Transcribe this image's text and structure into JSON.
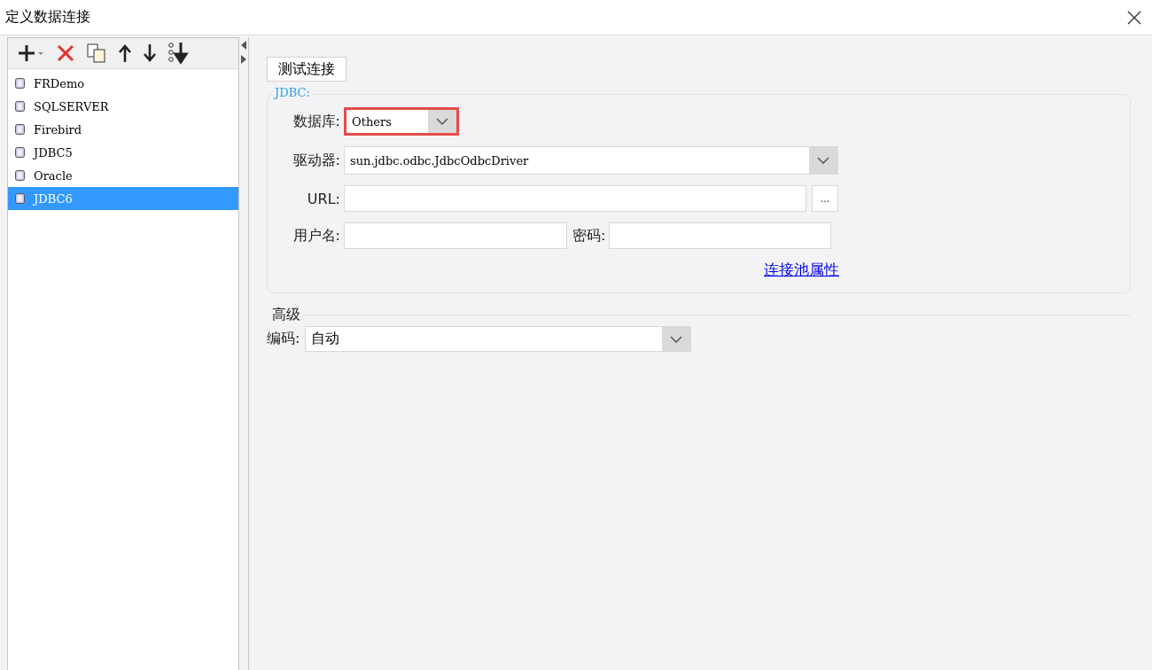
{
  "window": {
    "title": "定义数据连接"
  },
  "connections": [
    {
      "name": "FRDemo",
      "selected": false
    },
    {
      "name": "SQLSERVER",
      "selected": false
    },
    {
      "name": "Firebird",
      "selected": false
    },
    {
      "name": "JDBC5",
      "selected": false
    },
    {
      "name": "Oracle",
      "selected": false
    },
    {
      "name": "JDBC6",
      "selected": true
    }
  ],
  "test_button": "测试连接",
  "jdbc": {
    "legend": "JDBC:",
    "database": {
      "label": "数据库:",
      "value": "Others",
      "highlighted": true
    },
    "driver": {
      "label": "驱动器:",
      "value": "sun.jdbc.odbc.JdbcOdbcDriver"
    },
    "url": {
      "label": "URL:",
      "browse": "..."
    },
    "username": {
      "label": "用户名:"
    },
    "password": {
      "label": "密码:"
    },
    "pool_link": "连接池属性"
  },
  "advanced": {
    "legend": "高级",
    "encoding": {
      "label": "编码:",
      "value": "自动"
    }
  }
}
